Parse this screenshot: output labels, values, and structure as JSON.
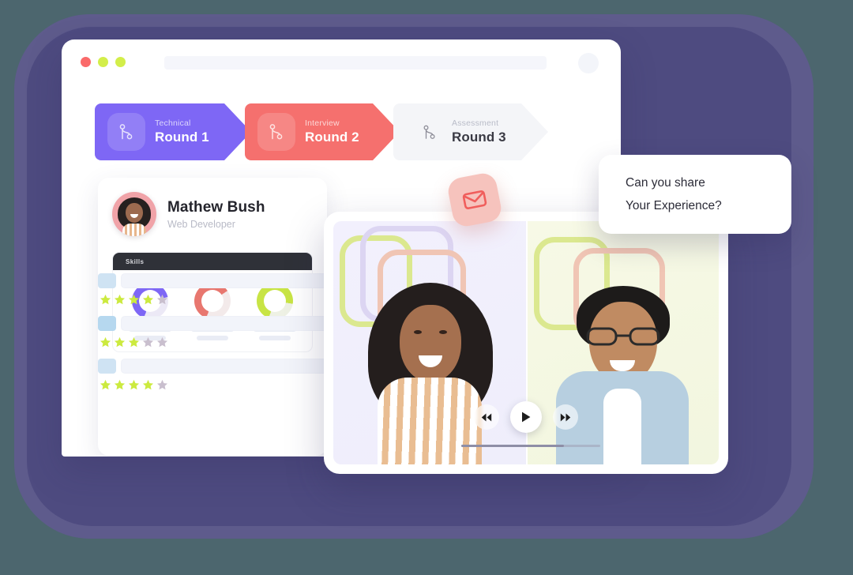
{
  "background": {
    "outer_color": "#4c666e",
    "blob_outer": "#5e5b8c",
    "blob_inner": "#4e4b80"
  },
  "browser": {
    "traffic_lights": [
      {
        "name": "close-dot",
        "color": "#fa6a6a"
      },
      {
        "name": "minimize-dot",
        "color": "#d3ee4a"
      },
      {
        "name": "maximize-dot",
        "color": "#d3ee4a"
      }
    ],
    "url_placeholder": "",
    "account_avatar": ""
  },
  "rounds": [
    {
      "sub": "Technical",
      "title": "Round 1",
      "state": "active",
      "color": "#7e67f5",
      "icon": "git-branch-icon"
    },
    {
      "sub": "Interview",
      "title": "Round 2",
      "state": "active",
      "color": "#f5706e",
      "icon": "git-branch-icon"
    },
    {
      "sub": "Assessment",
      "title": "Round 3",
      "state": "inactive",
      "color": "#f4f5f8",
      "icon": "git-branch-icon"
    }
  ],
  "profile": {
    "name": "Mathew Bush",
    "role": "Web Developer",
    "avatar_icon": "user-avatar",
    "skills_panel_title": "Skills",
    "skills": [
      {
        "percent": 66,
        "color": "#7e67f5",
        "track": "#ece9f6"
      },
      {
        "percent": 60,
        "color": "#e8776f",
        "track": "#f3eaea"
      },
      {
        "percent": 72,
        "color": "#c8e445",
        "track": "#eef1e4"
      }
    ]
  },
  "reviews": [
    {
      "chip": "a",
      "stars_filled": 4,
      "stars_total": 5
    },
    {
      "chip": "b",
      "stars_filled": 3,
      "stars_total": 5
    },
    {
      "chip": "a",
      "stars_filled": 4,
      "stars_total": 5
    }
  ],
  "review_colors": {
    "star_filled": "#ccea3f",
    "star_empty": "#c9bfce"
  },
  "skeleton": {
    "blocks": 1,
    "lines": 6
  },
  "video": {
    "panes": [
      {
        "name": "participant-left",
        "bg": "#f2f0fd",
        "person": "woman-smiling"
      },
      {
        "name": "participant-right",
        "bg": "#f7f9e6",
        "person": "man-with-glasses"
      }
    ],
    "controls": [
      {
        "name": "rewind-button",
        "glyph": "rewind-icon"
      },
      {
        "name": "play-button",
        "glyph": "play-icon"
      },
      {
        "name": "fast-forward-button",
        "glyph": "fast-forward-icon"
      }
    ],
    "progress_percent": 74
  },
  "mail_badge": {
    "icon": "envelope-icon",
    "bg": "#f6c3bd",
    "stroke": "#f05e5c"
  },
  "bubble": {
    "line1": "Can you share",
    "line2": "Your Experience?"
  }
}
